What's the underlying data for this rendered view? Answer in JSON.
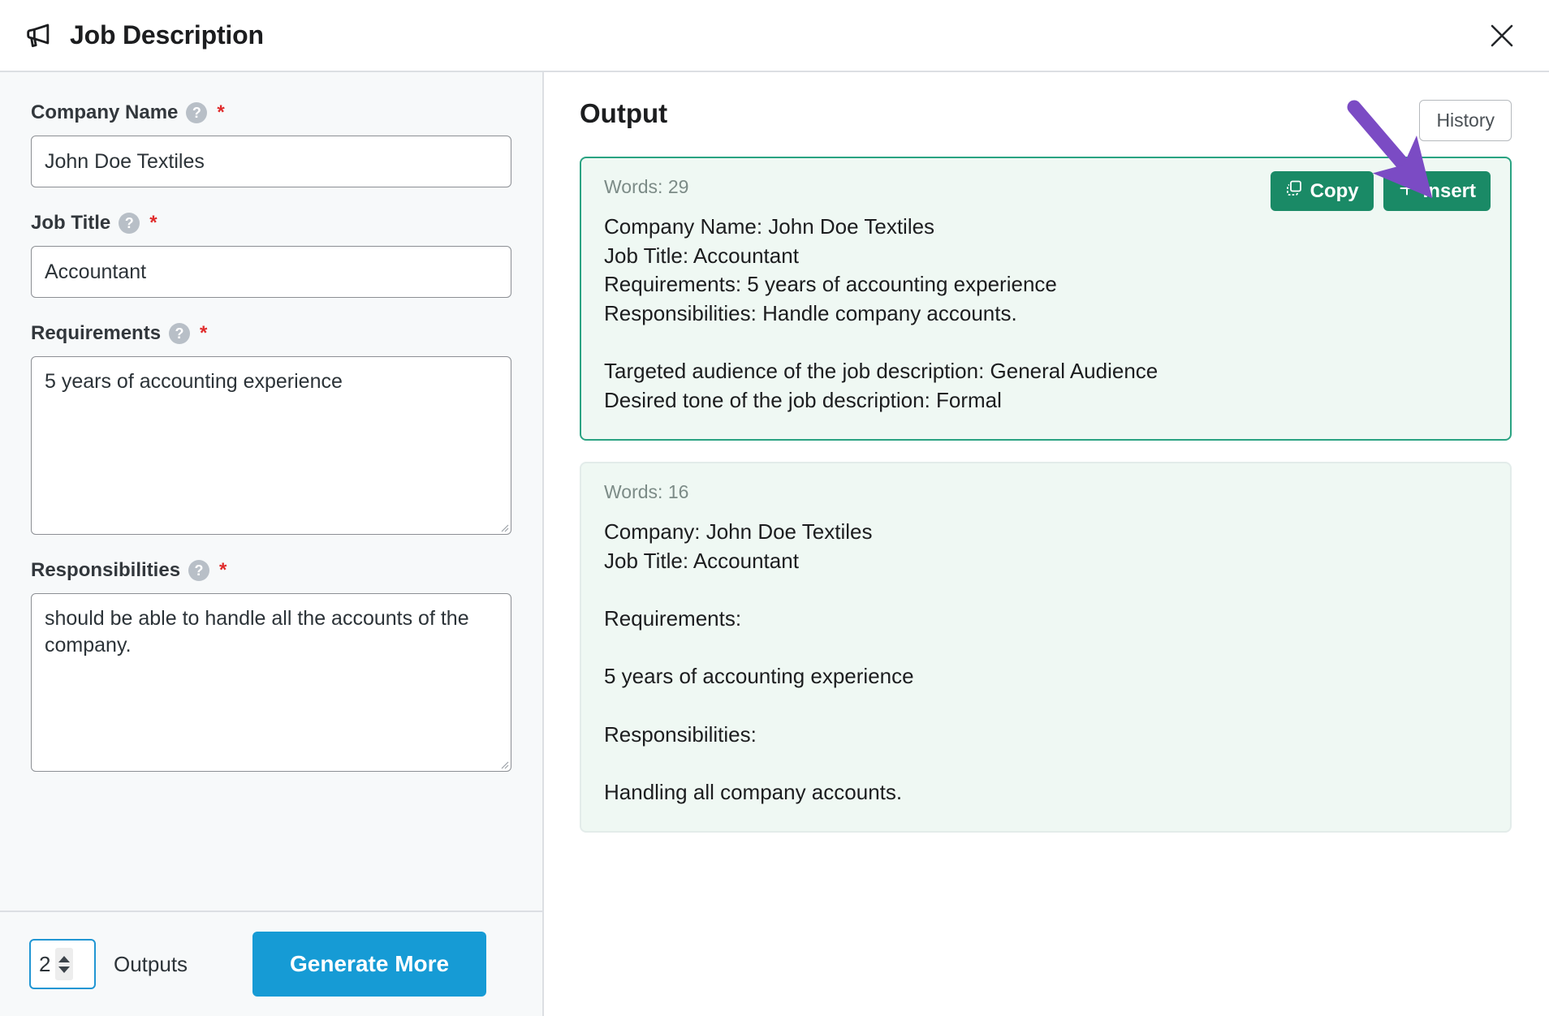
{
  "header": {
    "title": "Job Description",
    "icon": "megaphone-icon",
    "close_icon": "close-icon"
  },
  "form": {
    "fields": [
      {
        "label": "Company Name",
        "help_icon": "help-circle-icon",
        "required_marker": "*",
        "type": "input",
        "value": "John Doe Textiles",
        "placeholder": ""
      },
      {
        "label": "Job Title",
        "help_icon": "help-circle-icon",
        "required_marker": "*",
        "type": "input",
        "value": "Accountant",
        "placeholder": ""
      },
      {
        "label": "Requirements",
        "help_icon": "help-circle-icon",
        "required_marker": "*",
        "type": "textarea",
        "value": "5 years of accounting experience",
        "placeholder": ""
      },
      {
        "label": "Responsibilities",
        "help_icon": "help-circle-icon",
        "required_marker": "*",
        "type": "textarea",
        "value": "should be able to handle all the accounts of the company.",
        "placeholder": ""
      }
    ],
    "footer": {
      "outputs_count": "2",
      "outputs_label": "Outputs",
      "generate_label": "Generate More",
      "stepper_up_icon": "spinner-up-icon",
      "stepper_down_icon": "spinner-down-icon"
    }
  },
  "output": {
    "title": "Output",
    "history_label": "History",
    "cards": [
      {
        "words_label": "Words: 29",
        "text": "Company Name: John Doe Textiles\nJob Title: Accountant\nRequirements: 5 years of accounting experience\nResponsibilities: Handle company accounts.\n\nTargeted audience of the job description: General Audience\nDesired tone of the job description: Formal",
        "copy_label": "Copy",
        "copy_icon": "copy-icon",
        "insert_label": "Insert",
        "insert_icon": "plus-icon",
        "highlighted": true
      },
      {
        "words_label": "Words: 16",
        "text": "Company: John Doe Textiles\nJob Title: Accountant\n\nRequirements:\n\n5 years of accounting experience\n\nResponsibilities:\n\nHandling all company accounts.",
        "highlighted": false
      }
    ]
  },
  "annotation": {
    "type": "arrow",
    "points_to": "insert-button",
    "color": "#7b4bc4"
  },
  "colors": {
    "accent_blue": "#169bd5",
    "accent_green": "#1a8a66",
    "card_border_green": "#2aa382",
    "card_bg_green": "#eff8f3",
    "required_red": "#e02b2b",
    "panel_bg": "#f7f9fa",
    "annotation_purple": "#7b4bc4"
  }
}
